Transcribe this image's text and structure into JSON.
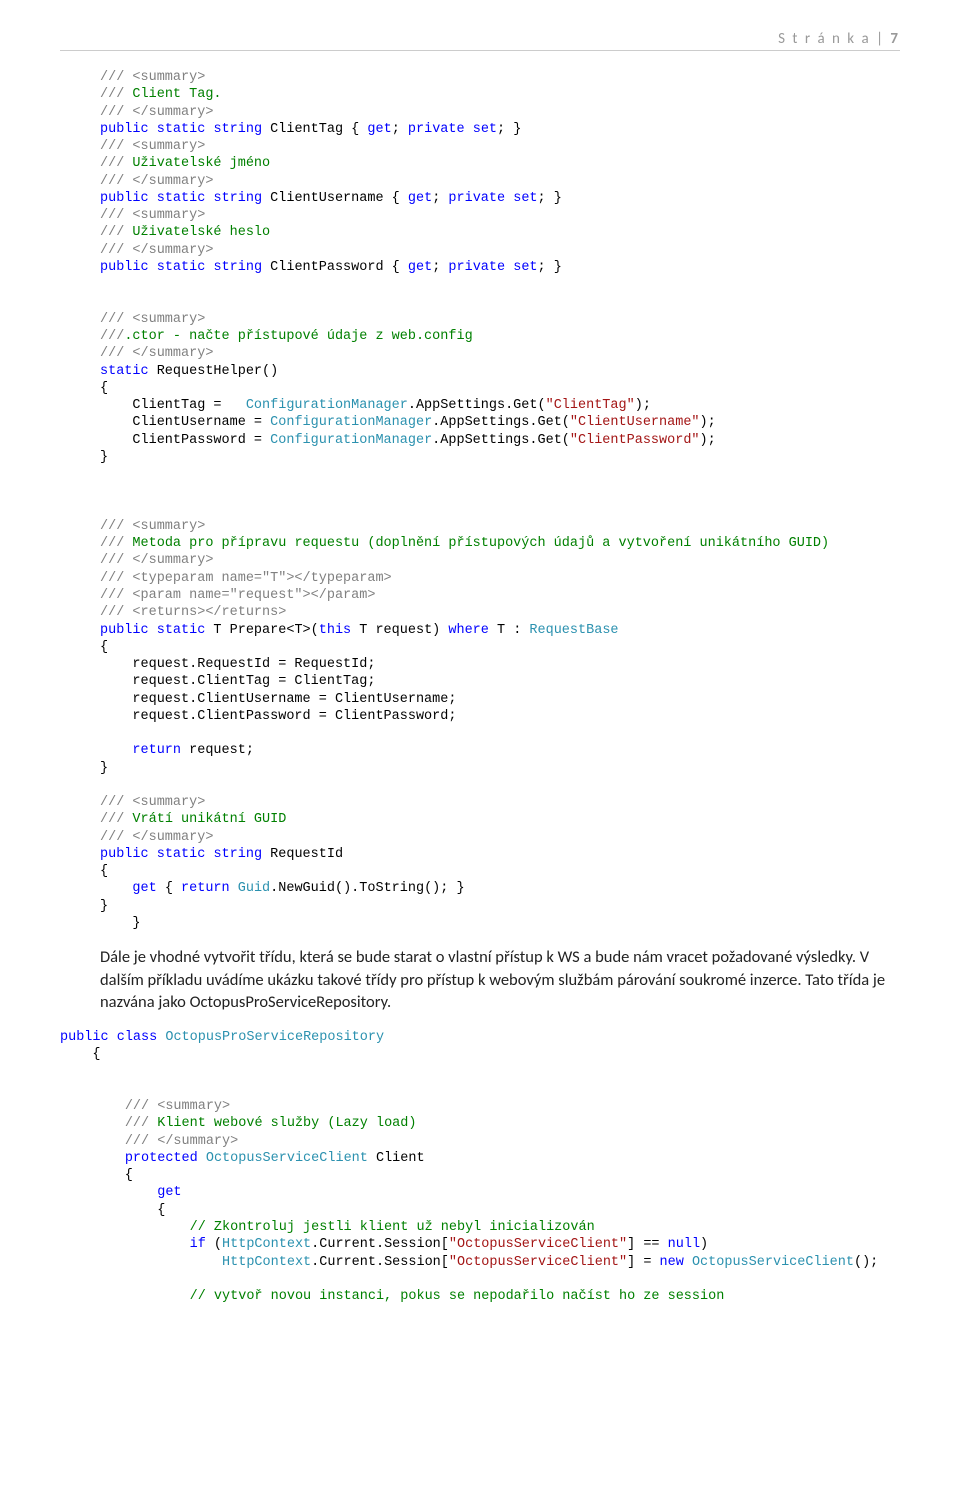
{
  "header": {
    "text": "S t r á n k a  | ",
    "page": "7"
  },
  "paragraph": "Dále je vhodné vytvořit třídu, která se bude starat o vlastní přístup k WS a bude nám vracet požadované výsledky. V dalším příkladu uvádíme ukázku takové třídy pro přístup k webovým službám párování soukromé inzerce. Tato třída je nazvána jako OctopusProServiceRepository.",
  "code1": {
    "summary_open": "/// <summary>",
    "clienttag_comment": "/// Client Tag.",
    "summary_close": "/// </summary>",
    "username_comment": "/// Uživatelské jméno",
    "password_comment": "/// Uživatelské heslo",
    "ctor_comment": "///.ctor - načte přístupové údaje z web.config",
    "metoda_comment": "/// Metoda pro přípravu requestu (doplnění přístupových údajů a vytvoření unikátního GUID)",
    "typeparam": "/// <typeparam name=\"T\"></typeparam>",
    "param_req": "/// <param name=\"request\"></param>",
    "returns": "/// <returns></returns>",
    "guid_comment": "/// Vrátí unikátní GUID",
    "kw_public": "public",
    "kw_static": "static",
    "kw_string": "string",
    "kw_get": "get",
    "kw_set": "set",
    "kw_private": "private",
    "kw_this": "this",
    "kw_where": "where",
    "kw_return": "return",
    "id_ClientTag": "ClientTag",
    "id_ClientUsername": "ClientUsername",
    "id_ClientPassword": "ClientPassword",
    "id_RequestHelper": "RequestHelper()",
    "id_CfgMgr": "ConfigurationManager",
    "id_AppSettings": ".AppSettings.Get(",
    "str_ClientTag": "\"ClientTag\"",
    "str_ClientUsername": "\"ClientUsername\"",
    "str_ClientPassword": "\"ClientPassword\"",
    "id_Prepare": "Prepare<T>(",
    "id_T": "T",
    "id_request": "request)",
    "id_RequestBase": "RequestBase",
    "line_reqid": "request.RequestId = RequestId;",
    "line_tag": "request.ClientTag = ClientTag;",
    "line_user": "request.ClientUsername = ClientUsername;",
    "line_pass": "request.ClientPassword = ClientPassword;",
    "ret_request": "return",
    "ret_request_tail": " request;",
    "id_RequestId": "RequestId",
    "id_Guid": "Guid",
    "guid_tail": ".NewGuid().ToString(); }"
  },
  "code2": {
    "kw_public": "public",
    "kw_class": "class",
    "id_Repo": "OctopusProServiceRepository",
    "summary_open": "/// <summary>",
    "klient_comment": "/// Klient webové služby (Lazy load)",
    "summary_close": "/// </summary>",
    "kw_protected": "protected",
    "id_Client": "OctopusServiceClient",
    "id_ClientProp": "Client",
    "kw_get": "get",
    "cmt_check": "// Zkontroluj jestli klient už nebyl inicializován",
    "kw_if": "if",
    "id_HttpCtx": "HttpContext",
    "session_part": ".Current.Session[",
    "str_key": "\"OctopusServiceClient\"",
    "eq_null": "] == ",
    "kw_null": "null",
    "kw_new": "new",
    "id_OSC": "OctopusServiceClient",
    "cmt_instance": "// vytvoř novou instanci, pokus se nepodařilo načíst ho ze session"
  }
}
